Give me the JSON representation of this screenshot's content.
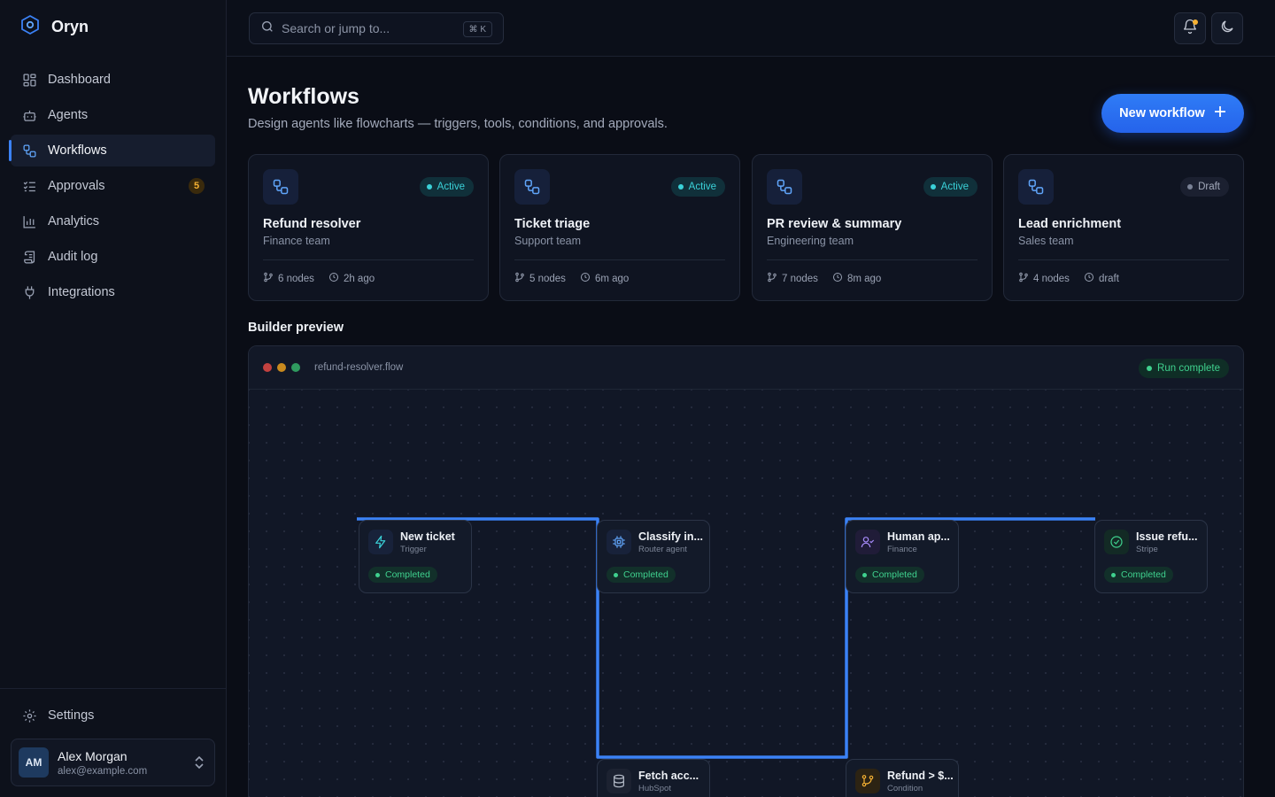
{
  "brand": {
    "name": "Oryn"
  },
  "sidebar": {
    "items": [
      {
        "label": "Dashboard",
        "icon": "dashboard-icon"
      },
      {
        "label": "Agents",
        "icon": "bot-icon"
      },
      {
        "label": "Workflows",
        "icon": "workflow-icon",
        "active": true
      },
      {
        "label": "Approvals",
        "icon": "list-check-icon",
        "badge": "5"
      },
      {
        "label": "Analytics",
        "icon": "bar-chart-icon"
      },
      {
        "label": "Audit log",
        "icon": "scroll-icon"
      },
      {
        "label": "Integrations",
        "icon": "plug-icon"
      }
    ],
    "settings": "Settings",
    "user": {
      "initials": "AM",
      "name": "Alex Morgan",
      "email": "alex@example.com"
    }
  },
  "topbar": {
    "search_placeholder": "Search or jump to...",
    "shortcut": "⌘ K"
  },
  "page": {
    "title": "Workflows",
    "subtitle": "Design agents like flowcharts — triggers, tools, conditions, and approvals.",
    "new_button": "New workflow"
  },
  "cards": [
    {
      "title": "Refund resolver",
      "team": "Finance team",
      "status": "Active",
      "nodes": "6 nodes",
      "time": "2h ago"
    },
    {
      "title": "Ticket triage",
      "team": "Support team",
      "status": "Active",
      "nodes": "5 nodes",
      "time": "6m ago"
    },
    {
      "title": "PR review & summary",
      "team": "Engineering team",
      "status": "Active",
      "nodes": "7 nodes",
      "time": "8m ago"
    },
    {
      "title": "Lead enrichment",
      "team": "Sales team",
      "status": "Draft",
      "nodes": "4 nodes",
      "time": "draft"
    }
  ],
  "builder": {
    "section_title": "Builder preview",
    "file_name": "refund-resolver.flow",
    "run_status": "Run complete",
    "nodes": [
      {
        "title": "New ticket",
        "sub": "Trigger",
        "status": "Completed",
        "icon": "bolt-icon"
      },
      {
        "title": "Classify in...",
        "sub": "Router agent",
        "status": "Completed",
        "icon": "cpu-icon"
      },
      {
        "title": "Human ap...",
        "sub": "Finance",
        "status": "Completed",
        "icon": "user-check-icon"
      },
      {
        "title": "Issue refu...",
        "sub": "Stripe",
        "status": "Completed",
        "icon": "check-circle-icon"
      },
      {
        "title": "Fetch acc...",
        "sub": "HubSpot",
        "icon": "database-icon"
      },
      {
        "title": "Refund > $...",
        "sub": "Condition",
        "icon": "git-branch-icon"
      }
    ]
  },
  "colors": {
    "accent": "#2563eb",
    "active_status": "#3ad1d8",
    "success": "#3fd18e",
    "warning": "#f5b133"
  }
}
